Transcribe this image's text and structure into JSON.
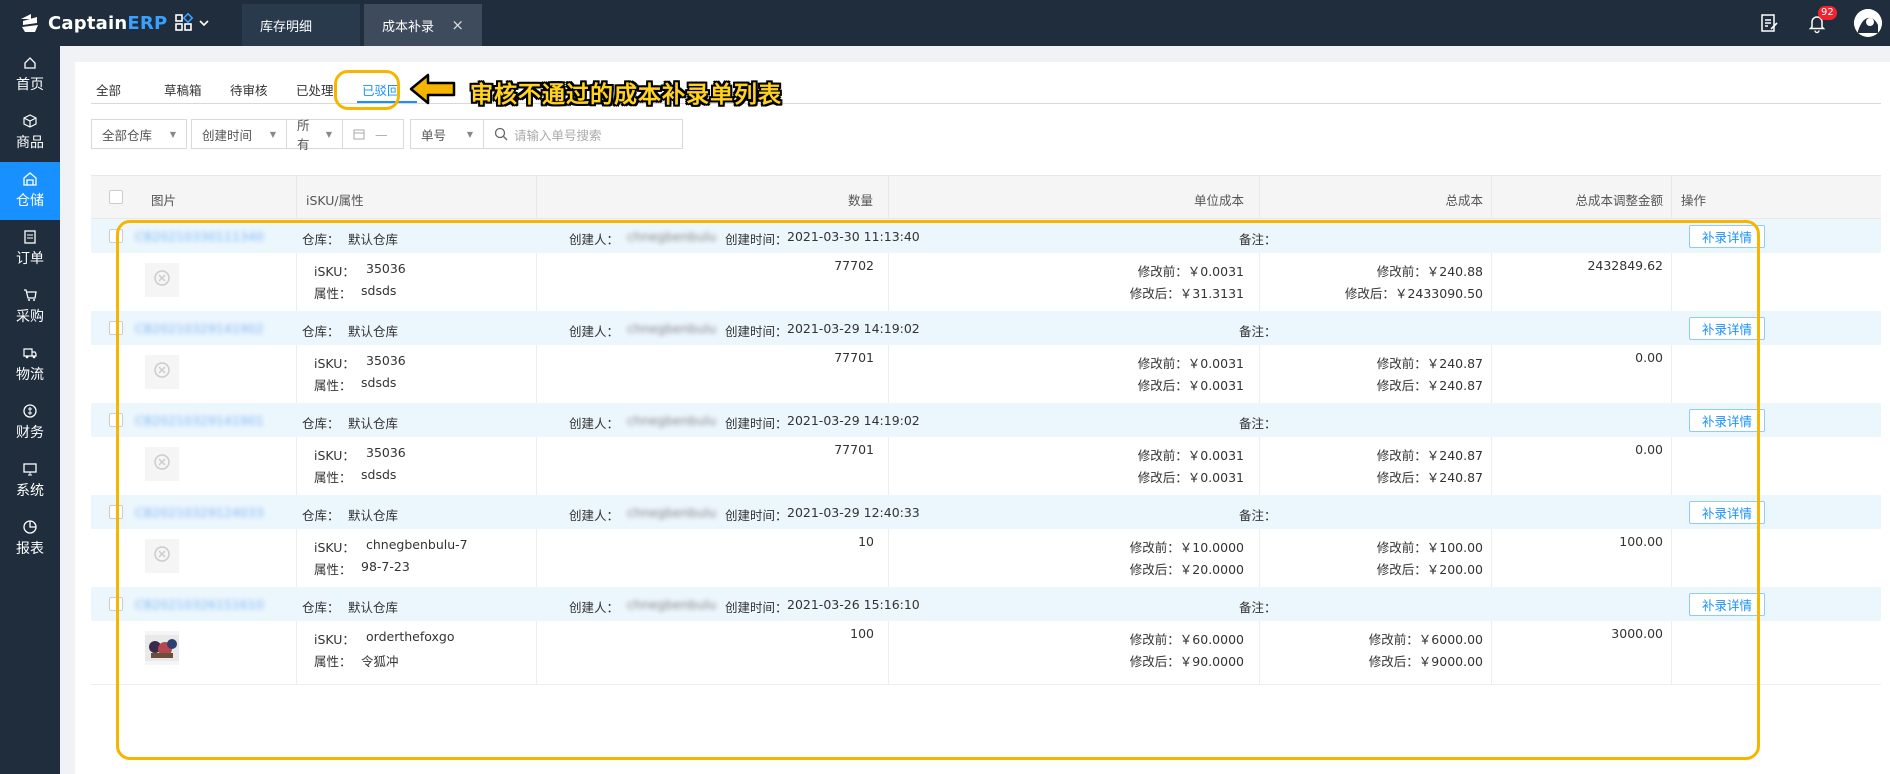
{
  "brand": {
    "name_main": "Captain",
    "name_accent": "ERP"
  },
  "window_tabs": [
    {
      "label": "库存明细"
    },
    {
      "label": "成本补录",
      "close": "×"
    }
  ],
  "notifications": {
    "count": "92"
  },
  "sidebar": {
    "items": [
      {
        "label": "首页",
        "icon": "home-icon"
      },
      {
        "label": "商品",
        "icon": "box-icon"
      },
      {
        "label": "仓储",
        "icon": "warehouse-icon"
      },
      {
        "label": "订单",
        "icon": "order-icon"
      },
      {
        "label": "采购",
        "icon": "cart-icon"
      },
      {
        "label": "物流",
        "icon": "truck-icon"
      },
      {
        "label": "财务",
        "icon": "finance-icon"
      },
      {
        "label": "系统",
        "icon": "system-icon"
      },
      {
        "label": "报表",
        "icon": "report-icon"
      }
    ],
    "active": 2
  },
  "status_tabs": [
    "全部",
    "草稿箱",
    "待审核",
    "已处理",
    "已驳回"
  ],
  "active_status_tab": 4,
  "callout": "审核不通过的成本补录单列表",
  "filters": {
    "warehouse": "全部仓库",
    "time_type": "创建时间",
    "range": "所有",
    "date_dash": "—",
    "field": "单号",
    "search_placeholder": "请输入单号搜索"
  },
  "columns": {
    "image": "图片",
    "sku": "iSKU/属性",
    "qty": "数量",
    "unit_cost": "单位成本",
    "total_cost": "总成本",
    "adjust": "总成本调整金额",
    "ops": "操作"
  },
  "labels": {
    "warehouse": "仓库：",
    "creator": "创建人：",
    "created": "创建时间：",
    "note": "备注：",
    "sku": "iSKU：",
    "attr": "属性：",
    "before": "修改前：",
    "after": "修改后：",
    "detail": "补录详情"
  },
  "rows": [
    {
      "order_no": "CB20210330111340",
      "warehouse": "默认仓库",
      "creator": "chnegbenbulu",
      "created": "2021-03-30 11:13:40",
      "sku": "35036",
      "attr": "sdsds",
      "qty": "77702",
      "unit_before": "￥0.0031",
      "unit_after": "￥31.3131",
      "total_before": "￥240.88",
      "total_after": "￥2433090.50",
      "adjust": "2432849.62",
      "image": "placeholder"
    },
    {
      "order_no": "CB20210329141902",
      "warehouse": "默认仓库",
      "creator": "chnegbenbulu",
      "created": "2021-03-29 14:19:02",
      "sku": "35036",
      "attr": "sdsds",
      "qty": "77701",
      "unit_before": "￥0.0031",
      "unit_after": "￥0.0031",
      "total_before": "￥240.87",
      "total_after": "￥240.87",
      "adjust": "0.00",
      "image": "placeholder"
    },
    {
      "order_no": "CB20210329141901",
      "warehouse": "默认仓库",
      "creator": "chnegbenbulu",
      "created": "2021-03-29 14:19:02",
      "sku": "35036",
      "attr": "sdsds",
      "qty": "77701",
      "unit_before": "￥0.0031",
      "unit_after": "￥0.0031",
      "total_before": "￥240.87",
      "total_after": "￥240.87",
      "adjust": "0.00",
      "image": "placeholder"
    },
    {
      "order_no": "CB20210329124033",
      "warehouse": "默认仓库",
      "creator": "chnegbenbulu",
      "created": "2021-03-29 12:40:33",
      "sku": "chnegbenbulu-7",
      "attr": "98-7-23",
      "qty": "10",
      "unit_before": "￥10.0000",
      "unit_after": "￥20.0000",
      "total_before": "￥100.00",
      "total_after": "￥200.00",
      "adjust": "100.00",
      "image": "placeholder"
    },
    {
      "order_no": "CB20210326151610",
      "warehouse": "默认仓库",
      "creator": "chnegbenbulu",
      "created": "2021-03-26 15:16:10",
      "sku": "orderthefoxgo",
      "attr": "令狐冲",
      "qty": "100",
      "unit_before": "￥60.0000",
      "unit_after": "￥90.0000",
      "total_before": "￥6000.00",
      "total_after": "￥9000.00",
      "adjust": "3000.00",
      "image": "photo"
    }
  ]
}
